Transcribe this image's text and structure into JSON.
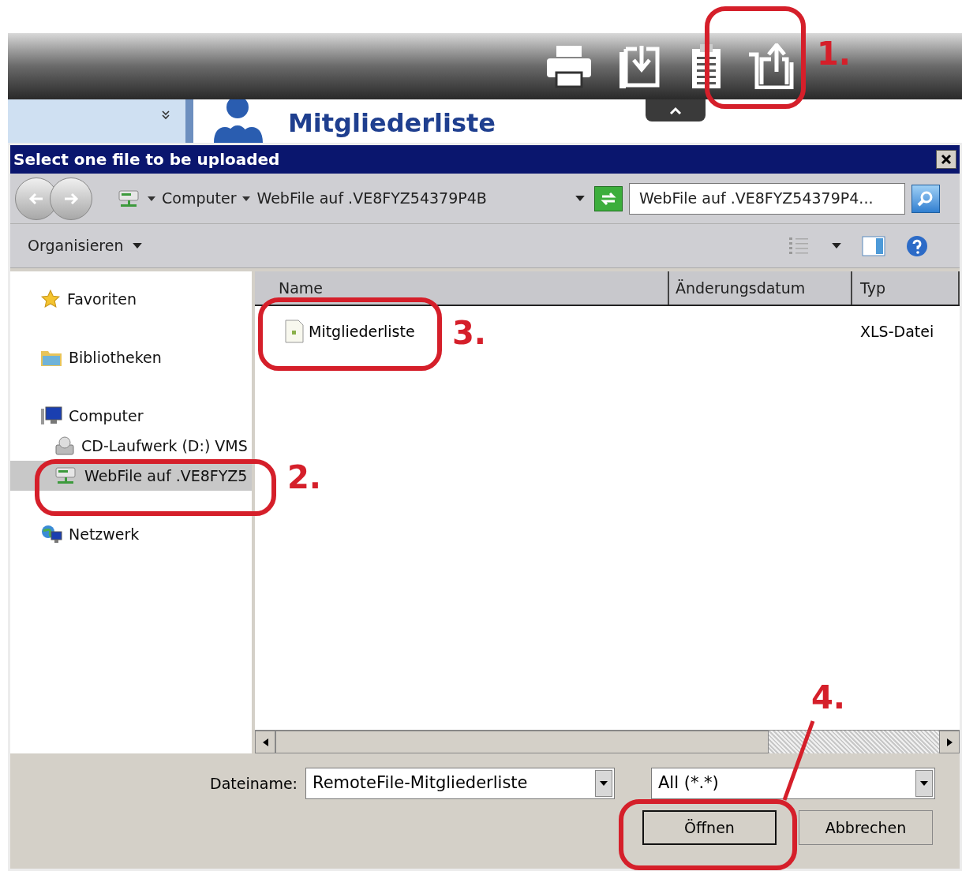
{
  "background_page": {
    "title": "Mitgliederliste"
  },
  "dialog": {
    "title": "Select one file to be uploaded",
    "address": {
      "breadcrumb": [
        "Computer",
        "WebFile auf .VE8FYZ54379P4B"
      ],
      "search_value": "WebFile auf .VE8FYZ54379P4..."
    },
    "toolbar": {
      "organize": "Organisieren"
    },
    "nav": [
      {
        "label": "Favoriten",
        "kind": "favorites",
        "selected": false
      },
      {
        "label": "Bibliotheken",
        "kind": "libraries",
        "selected": false
      },
      {
        "label": "Computer",
        "kind": "computer",
        "selected": false,
        "children": [
          {
            "label": "CD-Laufwerk (D:) VMS",
            "kind": "drive",
            "selected": false
          },
          {
            "label": "WebFile auf .VE8FYZ5",
            "kind": "webfile",
            "selected": true
          }
        ]
      },
      {
        "label": "Netzwerk",
        "kind": "network",
        "selected": false
      }
    ],
    "columns": [
      "Name",
      "Änderungsdatum",
      "Typ"
    ],
    "files": [
      {
        "name": "Mitgliederliste",
        "type": "XLS-Datei"
      }
    ],
    "filename": {
      "label": "Dateiname:",
      "value": "RemoteFile-Mitgliederliste"
    },
    "filter": {
      "value": "All (*.*)"
    },
    "buttons": [
      "Öffnen",
      "Abbrechen"
    ]
  },
  "annotations": [
    {
      "label": "1."
    },
    {
      "label": "2."
    },
    {
      "label": "3."
    },
    {
      "label": "4."
    }
  ]
}
